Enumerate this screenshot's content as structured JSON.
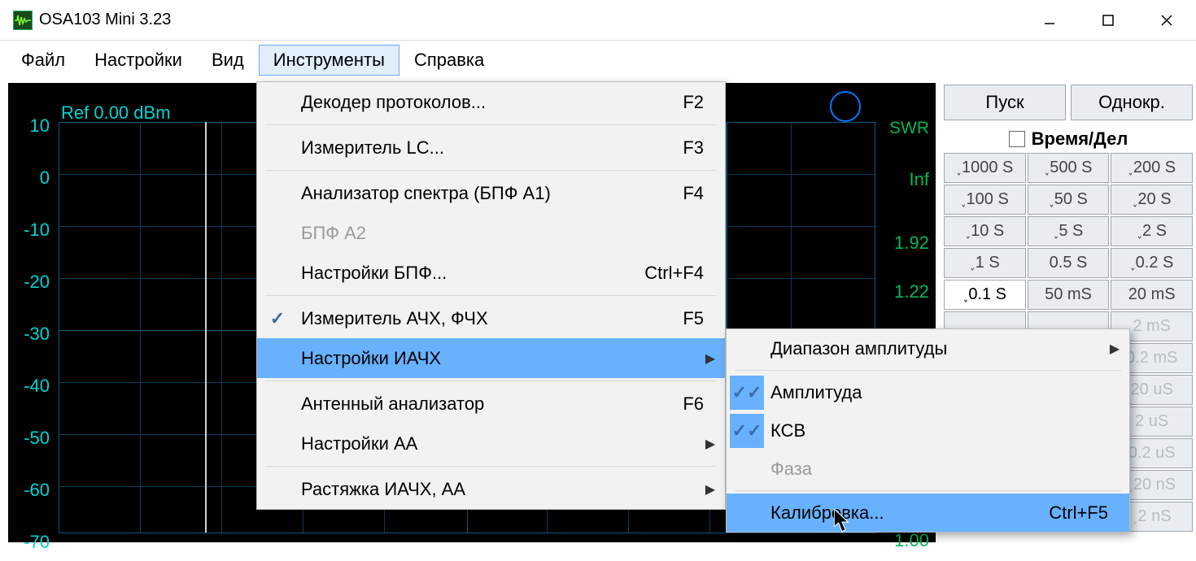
{
  "title": "OSA103 Mini 3.23",
  "menubar": {
    "file": "Файл",
    "settings": "Настройки",
    "view": "Вид",
    "instruments": "Инструменты",
    "help": "Справка"
  },
  "dropdown1": {
    "decoder": "Декодер протоколов...",
    "decoder_sc": "F2",
    "lc": "Измеритель LC...",
    "lc_sc": "F3",
    "sa": "Анализатор спектра (БПФ A1)",
    "sa_sc": "F4",
    "fft2": "БПФ A2",
    "fft_set": "Настройки БПФ...",
    "fft_set_sc": "Ctrl+F4",
    "afc": "Измеритель АЧХ, ФЧХ",
    "afc_sc": "F5",
    "iac": "Настройки ИАЧХ",
    "ant": "Антенный анализатор",
    "ant_sc": "F6",
    "aa_set": "Настройки АА",
    "stretch": "Растяжка ИАЧХ, АА"
  },
  "dropdown2": {
    "amp_range": "Диапазон амплитуды",
    "amp": "Амплитуда",
    "vswr": "КСВ",
    "phase": "Фаза",
    "cal": "Калибровка...",
    "cal_sc": "Ctrl+F5"
  },
  "graph": {
    "ref": "Ref  0.00 dBm",
    "swr_label": "SWR",
    "swr_vals": [
      "Inf",
      "1.92",
      "1.22",
      "1.00"
    ],
    "y_vals": [
      "10",
      "0",
      "-10",
      "-20",
      "-30",
      "-40",
      "-50",
      "-60",
      "-70"
    ]
  },
  "side": {
    "start": "Пуск",
    "single": "Однокр.",
    "timediv": "Время/Дел",
    "rows": [
      [
        "˯1000 S",
        "˯500 S",
        "˯200 S"
      ],
      [
        "˯100 S",
        "˯50 S",
        "˯20 S"
      ],
      [
        "˯10 S",
        "˯5 S",
        "˯2 S"
      ],
      [
        "˯1 S",
        "0.5 S",
        "˯0.2 S"
      ],
      [
        "˯0.1 S",
        "50 mS",
        "20 mS"
      ]
    ],
    "rows_dis": [
      [
        "",
        "",
        "2 mS"
      ],
      [
        "",
        "",
        "0.2 mS"
      ],
      [
        "",
        "",
        "20 uS"
      ],
      [
        "",
        "",
        "2 uS"
      ],
      [
        "",
        "",
        "0.2 uS"
      ],
      [
        "",
        "",
        "˯20 nS"
      ],
      [
        "",
        "",
        "˯2 nS"
      ]
    ]
  }
}
